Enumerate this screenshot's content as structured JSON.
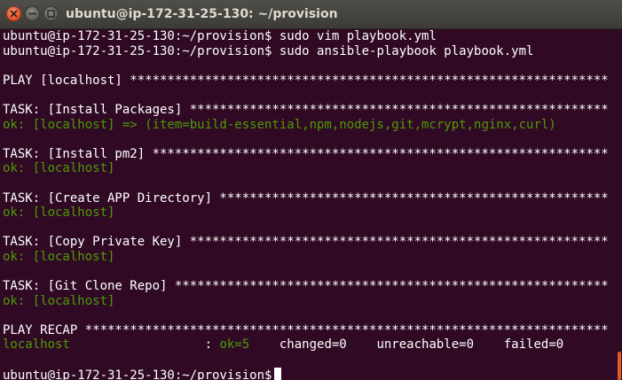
{
  "window": {
    "title": "ubuntu@ip-172-31-25-130: ~/provision"
  },
  "terminal": {
    "lines": [
      {
        "prefix": "ubuntu@ip-172-31-25-130:~/provision$ ",
        "text": "sudo vim playbook.yml",
        "style": "normal"
      },
      {
        "prefix": "ubuntu@ip-172-31-25-130:~/provision$ ",
        "text": "sudo ansible-playbook playbook.yml",
        "style": "normal"
      },
      {
        "prefix": "",
        "text": "",
        "style": "normal"
      },
      {
        "prefix": "",
        "text": "PLAY [localhost] ****************************************************************",
        "style": "normal"
      },
      {
        "prefix": "",
        "text": "",
        "style": "normal"
      },
      {
        "prefix": "",
        "text": "TASK: [Install Packages] ********************************************************",
        "style": "normal"
      },
      {
        "prefix": "",
        "text": "ok: [localhost] => (item=build-essential,npm,nodejs,git,mcrypt,nginx,curl)",
        "style": "ok"
      },
      {
        "prefix": "",
        "text": "",
        "style": "normal"
      },
      {
        "prefix": "",
        "text": "TASK: [Install pm2] *************************************************************",
        "style": "normal"
      },
      {
        "prefix": "",
        "text": "ok: [localhost]",
        "style": "ok"
      },
      {
        "prefix": "",
        "text": "",
        "style": "normal"
      },
      {
        "prefix": "",
        "text": "TASK: [Create APP Directory] ****************************************************",
        "style": "normal"
      },
      {
        "prefix": "",
        "text": "ok: [localhost]",
        "style": "ok"
      },
      {
        "prefix": "",
        "text": "",
        "style": "normal"
      },
      {
        "prefix": "",
        "text": "TASK: [Copy Private Key] ********************************************************",
        "style": "normal"
      },
      {
        "prefix": "",
        "text": "ok: [localhost]",
        "style": "ok"
      },
      {
        "prefix": "",
        "text": "",
        "style": "normal"
      },
      {
        "prefix": "",
        "text": "TASK: [Git Clone Repo] **********************************************************",
        "style": "normal"
      },
      {
        "prefix": "",
        "text": "ok: [localhost]",
        "style": "ok"
      },
      {
        "prefix": "",
        "text": "",
        "style": "normal"
      },
      {
        "prefix": "",
        "text": "PLAY RECAP **********************************************************************",
        "style": "normal"
      }
    ],
    "recap": {
      "host": "localhost",
      "separator": "                  : ",
      "ok": "ok=5",
      "changed": "    changed=0",
      "unreachable": "    unreachable=0",
      "failed": "    failed=0"
    },
    "prompt": {
      "prefix": "ubuntu@ip-172-31-25-130:~/provision$",
      "text": ""
    }
  },
  "colors": {
    "background": "#300a24",
    "foreground": "#ffffff",
    "ok": "#4e9a06",
    "scroll_thumb": "#e05a2c"
  },
  "icons": {
    "close": "close-icon",
    "minimize": "minimize-icon",
    "maximize": "maximize-icon"
  }
}
